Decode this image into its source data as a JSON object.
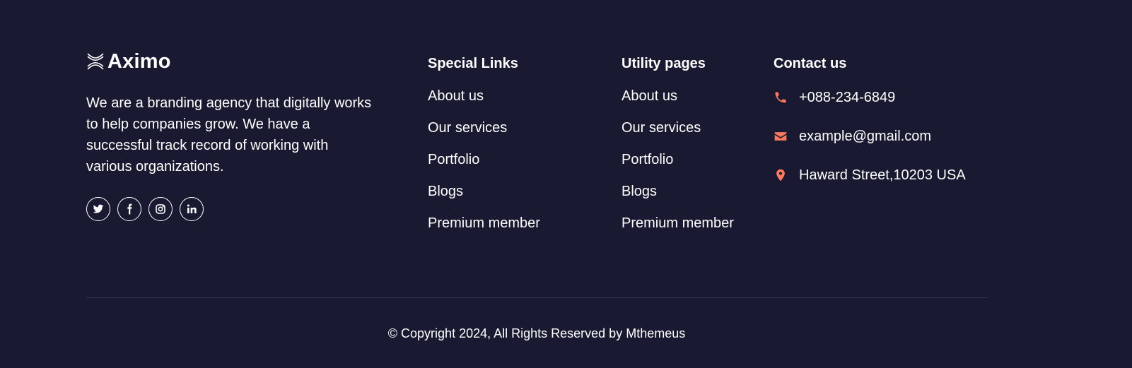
{
  "brand": {
    "name": "Aximo",
    "description": "We are a branding agency that digitally works to help companies grow. We have a successful track record of working with various organizations."
  },
  "socials": [
    {
      "icon": "twitter-icon"
    },
    {
      "icon": "facebook-icon"
    },
    {
      "icon": "instagram-icon"
    },
    {
      "icon": "linkedin-icon"
    }
  ],
  "special_links": {
    "title": "Special Links",
    "items": [
      "About us",
      "Our services",
      "Portfolio",
      "Blogs",
      "Premium member"
    ]
  },
  "utility_pages": {
    "title": "Utility pages",
    "items": [
      "About us",
      "Our services",
      "Portfolio",
      "Blogs",
      "Premium member"
    ]
  },
  "contact": {
    "title": "Contact us",
    "phone": "+088-234-6849",
    "email": "example@gmail.com",
    "address": "Haward Street,10203 USA",
    "icon_color": "#ff7a5c"
  },
  "copyright": "© Copyright 2024, All Rights Reserved by Mthemeus",
  "colors": {
    "background": "#1a1932",
    "text": "#ffffff",
    "accent": "#ff7a5c"
  }
}
